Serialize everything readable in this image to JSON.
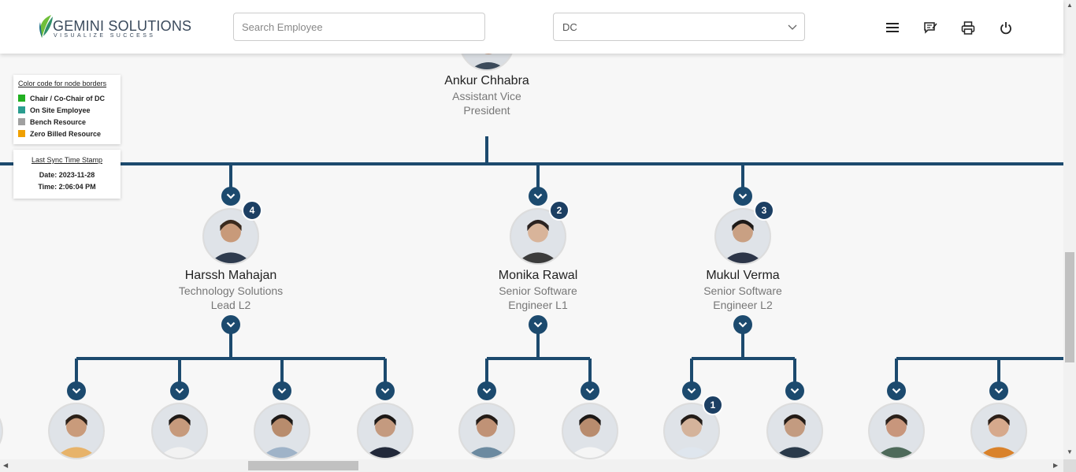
{
  "header": {
    "logo_title": "GEMINI SOLUTIONS",
    "logo_tagline": "VISUALIZE SUCCESS",
    "search_placeholder": "Search Employee",
    "dept_select_value": "DC",
    "icons": [
      "menu-icon",
      "feedback-icon",
      "print-icon",
      "power-icon"
    ]
  },
  "legend": {
    "title": "Color code for node borders",
    "items": [
      {
        "label": "Chair / Co-Chair of DC",
        "color": "#22b022"
      },
      {
        "label": "On Site Employee",
        "color": "#2a9d8f"
      },
      {
        "label": "Bench Resource",
        "color": "#a0a0a0"
      },
      {
        "label": "Zero Billed Resource",
        "color": "#f0a000"
      }
    ]
  },
  "sync": {
    "title": "Last Sync Time Stamp",
    "date": "Date: 2023-11-28",
    "time": "Time: 2:06:04 PM"
  },
  "top": {
    "name": "Ankur Chhabra",
    "role": "Assistant Vice President"
  },
  "managers": [
    {
      "name": "Harssh Mahajan",
      "role": "Technology Solutions Lead L2",
      "reports": "4",
      "skin": "#c89a7a",
      "hair": "#3a2a1e",
      "cloth": "#2e3b4e"
    },
    {
      "name": "Monika Rawal",
      "role": "Senior Software Engineer L1",
      "reports": "2",
      "skin": "#d8b49a",
      "hair": "#2a2220",
      "cloth": "#3c3c3c"
    },
    {
      "name": "Mukul Verma",
      "role": "Senior Software Engineer L2",
      "reports": "3",
      "skin": "#c9a083",
      "hair": "#1e1a18",
      "cloth": "#2c3548"
    }
  ],
  "children": [
    {
      "badge": "",
      "skin": "#c99b7b",
      "hair": "#2b2018",
      "cloth": "#e7b36a"
    },
    {
      "badge": "",
      "skin": "#c69a7c",
      "hair": "#1f1a17",
      "cloth": "#f2f2f2"
    },
    {
      "badge": "",
      "skin": "#b88c6d",
      "hair": "#1d1917",
      "cloth": "#9fb3c8"
    },
    {
      "badge": "",
      "skin": "#c49a7f",
      "hair": "#1c1816",
      "cloth": "#22293a"
    },
    {
      "badge": "",
      "skin": "#c09276",
      "hair": "#241c17",
      "cloth": "#6c8aa0"
    },
    {
      "badge": "",
      "skin": "#b88c6e",
      "hair": "#1c1816",
      "cloth": "#f5f5f5"
    },
    {
      "badge": "1",
      "skin": "#d4b39b",
      "hair": "#231c18",
      "cloth": "#dfe6ee"
    },
    {
      "badge": "",
      "skin": "#c39b80",
      "hair": "#231b16",
      "cloth": "#2a3a4a"
    },
    {
      "badge": "",
      "skin": "#c8967c",
      "hair": "#2a201a",
      "cloth": "#4e6a5a"
    },
    {
      "badge": "",
      "skin": "#d6a98c",
      "hair": "#2c1f18",
      "cloth": "#d9822b"
    }
  ]
}
